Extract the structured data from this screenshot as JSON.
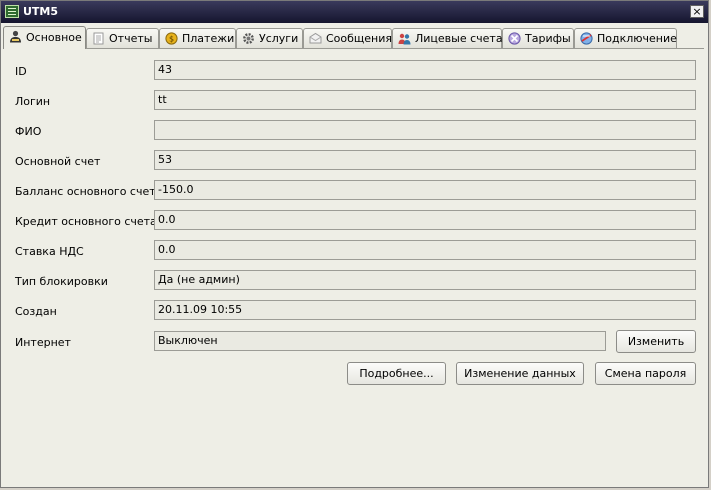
{
  "window": {
    "title": "UTM5",
    "close_glyph": "×",
    "app_icon": "utm5-app-icon"
  },
  "tabs": [
    {
      "label": "Основное",
      "icon": "user-icon",
      "active": true
    },
    {
      "label": "Отчеты",
      "icon": "report-icon",
      "active": false
    },
    {
      "label": "Платежи",
      "icon": "coin-icon",
      "active": false
    },
    {
      "label": "Услуги",
      "icon": "gear-icon",
      "active": false
    },
    {
      "label": "Сообщения",
      "icon": "envelope-icon",
      "active": false
    },
    {
      "label": "Лицевые счета",
      "icon": "users-icon",
      "active": false
    },
    {
      "label": "Тарифы",
      "icon": "tariff-icon",
      "active": false
    },
    {
      "label": "Подключение",
      "icon": "connection-icon",
      "active": false
    }
  ],
  "form": {
    "fields": [
      {
        "label": "ID",
        "value": "43"
      },
      {
        "label": "Логин",
        "value": "tt"
      },
      {
        "label": "ФИО",
        "value": ""
      },
      {
        "label": "Основной счет",
        "value": "53"
      },
      {
        "label": "Балланс основного счета",
        "value": "-150.0"
      },
      {
        "label": "Кредит основного счета",
        "value": "0.0"
      },
      {
        "label": "Ставка НДС",
        "value": "0.0"
      },
      {
        "label": "Тип блокировки",
        "value": "Да (не админ)"
      },
      {
        "label": "Создан",
        "value": "20.11.09 10:55"
      },
      {
        "label": "Интернет",
        "value": "Выключен"
      }
    ],
    "change_button": "Изменить",
    "more_button": "Подробнее...",
    "edit_data_button": "Изменение данных",
    "change_password_button": "Смена пароля"
  },
  "colors": {
    "titlebar": "#15152e",
    "window_bg": "#eeeee6",
    "field_bg": "#eaeae2"
  }
}
